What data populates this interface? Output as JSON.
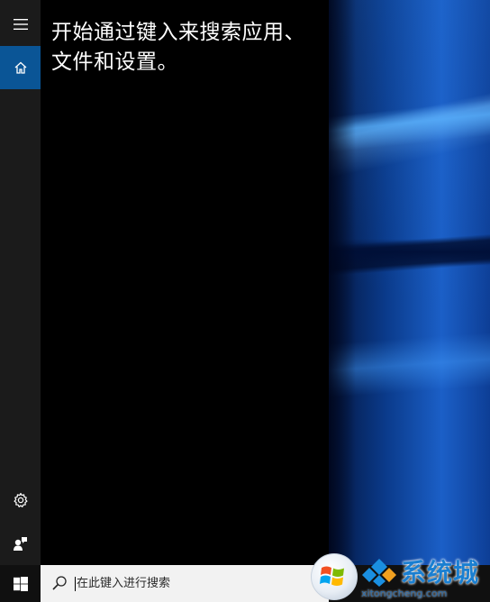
{
  "panel": {
    "prompt": "开始通过键入来搜索应用、文件和设置。"
  },
  "rail": {
    "items": [
      {
        "icon": "hamburger-menu-icon"
      },
      {
        "icon": "home-icon",
        "selected": true
      },
      {
        "icon": "gear-icon"
      },
      {
        "icon": "feedback-icon"
      }
    ]
  },
  "taskbar": {
    "start_icon": "windows-logo-icon",
    "search": {
      "placeholder": "在此键入进行搜索",
      "icon": "search-icon"
    }
  },
  "watermark": {
    "title": "系统城",
    "url": "xitongcheng.com"
  },
  "colors": {
    "rail_bg": "#1b1b1b",
    "accent": "#0a5596",
    "panel_bg": "#000000",
    "taskbar_bg": "#101010",
    "search_bg": "#f2f2f2",
    "watermark_blue": "#1a7fd1"
  }
}
